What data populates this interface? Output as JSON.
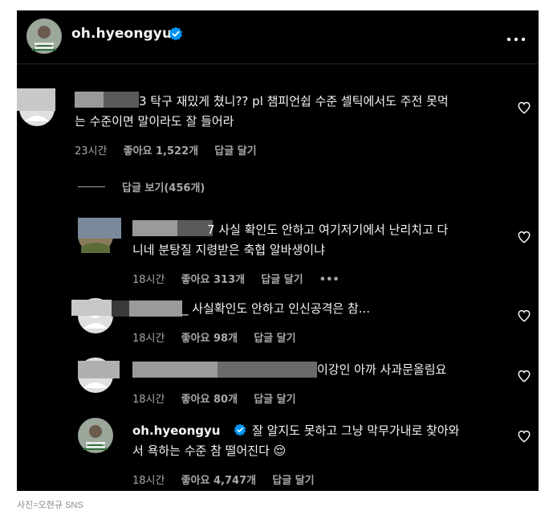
{
  "header": {
    "username": "oh.hyeongyu",
    "verified": true
  },
  "comments": [
    {
      "line1": "3 탁구 재밌게 쳤니?? pl 챔피언쉽 수준 셀틱에서도 주전 못먹",
      "line2": "는 수준이면 말이라도 잘 들어라",
      "time": "23시간",
      "likes": "좋아요 1,522개",
      "reply": "답글 달기"
    }
  ],
  "view_replies": "답글 보기(456개)",
  "replies": [
    {
      "line1": "7 사실 확인도 안하고 여기저기에서 난리치고 다",
      "line2": "니네 분탕질 지령받은 축협 알바생이냐",
      "time": "18시간",
      "likes": "좋아요 313개",
      "reply": "답글 달기",
      "more": "•••"
    },
    {
      "line1": "_ 사실확인도 안하고 인신공격은 참...",
      "time": "18시간",
      "likes": "좋아요 98개",
      "reply": "답글 달기"
    },
    {
      "line1": "이강인 아까 사과문올림요",
      "time": "18시간",
      "likes": "좋아요 80개",
      "reply": "답글 달기"
    },
    {
      "username": "oh.hyeongyu",
      "line1": "잘 알지도 못하고 그냥 막무가내로 찾아와",
      "line2": "서 욕하는 수준 참 떨어진다 😌",
      "time": "18시간",
      "likes": "좋아요 4,747개",
      "reply": "답글 달기"
    }
  ],
  "caption": "사진=오현규 SNS",
  "colors": {
    "background": "#000000",
    "text": "#f5f5f5",
    "secondary": "#a8a8a8",
    "verified": "#0095f6"
  }
}
